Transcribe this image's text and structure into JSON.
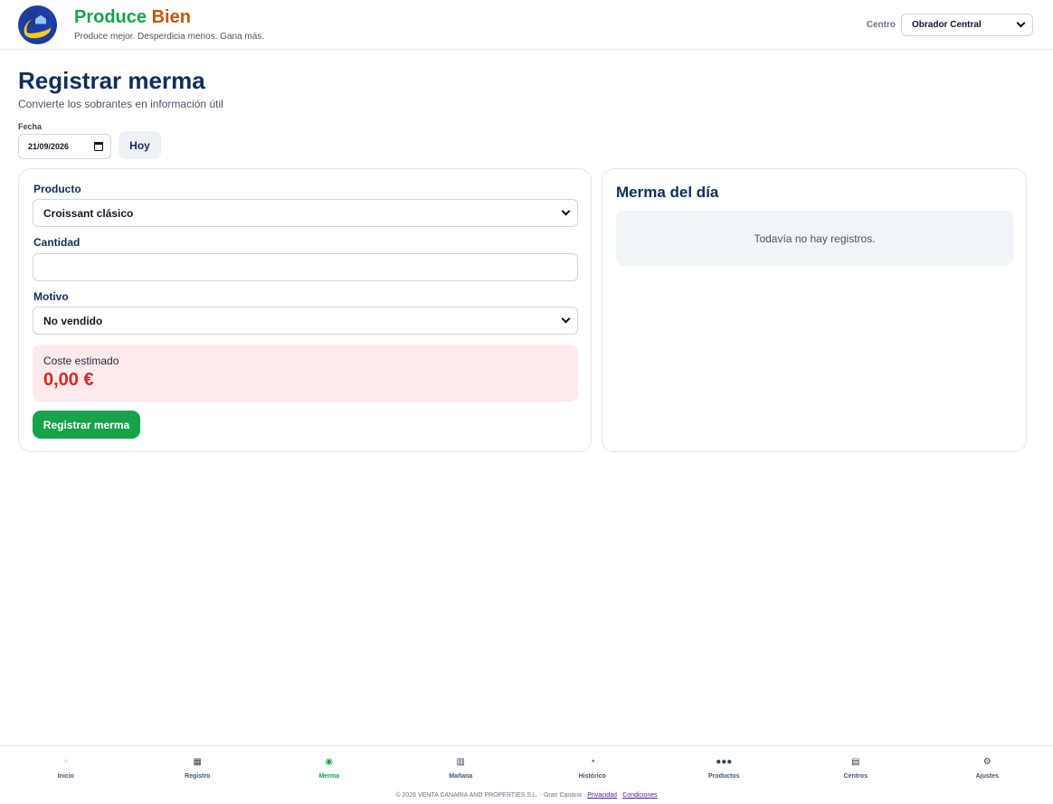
{
  "header": {
    "brand_first": "Produce",
    "brand_second": "Bien",
    "tagline": "Produce mejor. Desperdicia menos. Gana más.",
    "centro_label": "Centro",
    "centro_value": "Obrador Central"
  },
  "page": {
    "title": "Registrar merma",
    "subtitle": "Convierte los sobrantes en información útil",
    "fecha_label": "Fecha",
    "fecha_value": "21/09/2026",
    "hoy_button": "Hoy"
  },
  "form": {
    "producto_label": "Producto",
    "producto_value": "Croissant clásico",
    "cantidad_label": "Cantidad",
    "cantidad_value": "",
    "motivo_label": "Motivo",
    "motivo_value": "No vendido",
    "coste_label": "Coste estimado",
    "coste_value": "0,00 €",
    "submit_label": "Registrar merma"
  },
  "merma_dia": {
    "title": "Merma del día",
    "empty_text": "Todavía no hay registros."
  },
  "nav": {
    "items": [
      {
        "label": "Inicio",
        "icon": "home-icon"
      },
      {
        "label": "Registro",
        "icon": "grid-icon"
      },
      {
        "label": "Merma",
        "icon": "target-icon"
      },
      {
        "label": "Mañana",
        "icon": "calendar-icon"
      },
      {
        "label": "Histórico",
        "icon": "clock-icon"
      },
      {
        "label": "Productos",
        "icon": "dots-icon"
      },
      {
        "label": "Centros",
        "icon": "store-icon"
      },
      {
        "label": "Ajustes",
        "icon": "gear-icon"
      }
    ],
    "active": "Merma"
  },
  "footer": {
    "copyright": "© 2026 VENTA CANARIA AND PROPERTIES S.L. · Gran Canaria ·",
    "privacy": "Privacidad",
    "separator": "·",
    "terms": "Condiciones"
  }
}
